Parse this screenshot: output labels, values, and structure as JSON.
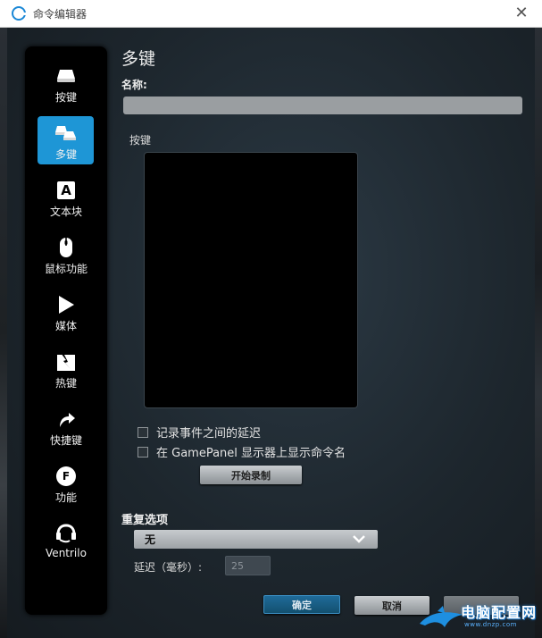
{
  "window": {
    "title": "命令编辑器",
    "close_symbol": "✕"
  },
  "sidebar": {
    "items": [
      {
        "label": "按键",
        "icon": "keyboard-key-icon",
        "active": false
      },
      {
        "label": "多键",
        "icon": "multi-key-icon",
        "active": true
      },
      {
        "label": "文本块",
        "icon": "text-block-icon",
        "active": false
      },
      {
        "label": "鼠标功能",
        "icon": "mouse-icon",
        "active": false
      },
      {
        "label": "媒体",
        "icon": "play-icon",
        "active": false
      },
      {
        "label": "热键",
        "icon": "hotkey-icon",
        "active": false
      },
      {
        "label": "快捷键",
        "icon": "shortcut-arrow-icon",
        "active": false
      },
      {
        "label": "功能",
        "icon": "function-gear-icon",
        "active": false
      },
      {
        "label": "Ventrilo",
        "icon": "headset-icon",
        "active": false
      }
    ],
    "text_block_glyph": "A",
    "function_glyph": "F"
  },
  "main": {
    "heading": "多键",
    "name_label": "名称:",
    "name_value": "",
    "keys_label": "按键",
    "options": {
      "record_delays": "记录事件之间的延迟",
      "show_name": "在 GamePanel 显示器上显示命令名"
    },
    "start_recording": "开始录制"
  },
  "repeat": {
    "label": "重复选项",
    "selected": "无",
    "delay_label": "延迟（毫秒）:",
    "delay_value": "25"
  },
  "footer": {
    "ok": "确定",
    "cancel": "取消"
  },
  "watermark": {
    "title": "电脑配置网",
    "url": "www.dnzp.com"
  },
  "colors": {
    "accent": "#1e96d6",
    "ok_button": "#1f6b99"
  }
}
